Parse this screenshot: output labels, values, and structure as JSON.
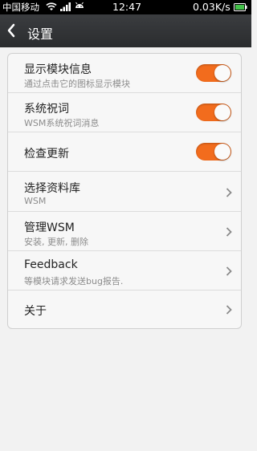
{
  "status_bar": {
    "carrier": "中国移动",
    "time": "12:47",
    "net_speed": "0.03K/s",
    "icons": [
      "wifi-icon",
      "signal-icon",
      "android-icon",
      "battery-icon"
    ]
  },
  "action_bar": {
    "title": "设置",
    "back_icon": "back-chevron-icon"
  },
  "settings": [
    {
      "label": "显示模块信息",
      "sub": "通过点击它的图标显示模块",
      "toggle": true,
      "on": true
    },
    {
      "label": "系统祝词",
      "sub": "WSM系统祝词消息",
      "toggle": true,
      "on": true
    },
    {
      "label": "检查更新",
      "sub": "",
      "toggle": true,
      "on": true
    },
    {
      "label": "选择资料库",
      "sub": "WSM",
      "toggle": false
    },
    {
      "label": "管理WSM",
      "sub": "安装, 更新, 删除",
      "toggle": false
    },
    {
      "label": "Feedback",
      "sub": "等模块请求发送bug报告.",
      "toggle": false
    },
    {
      "label": "关于",
      "sub": "",
      "toggle": false
    }
  ],
  "colors": {
    "accent": "#f26c1d",
    "action_bar": "#333538",
    "background": "#f2f2f2"
  }
}
